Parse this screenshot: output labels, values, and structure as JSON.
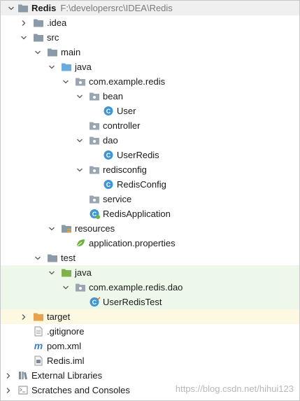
{
  "project": {
    "name": "Redis",
    "path": "F:\\developersrc\\IDEA\\Redis"
  },
  "nodes": {
    "idea": ".idea",
    "src": "src",
    "main": "main",
    "main_java": "java",
    "pkg": "com.example.redis",
    "bean": "bean",
    "user": "User",
    "controller": "controller",
    "dao": "dao",
    "user_redis": "UserRedis",
    "redisconfig": "redisconfig",
    "redis_config": "RedisConfig",
    "service": "service",
    "redis_application": "RedisApplication",
    "resources": "resources",
    "app_props": "application.properties",
    "test": "test",
    "test_java": "java",
    "test_pkg": "com.example.redis.dao",
    "user_redis_test": "UserRedisTest",
    "target": "target",
    "gitignore": ".gitignore",
    "pom": "pom.xml",
    "iml": "Redis.iml",
    "external_libraries": "External Libraries",
    "scratches": "Scratches and Consoles"
  },
  "watermark": "https://blog.csdn.net/hihui123",
  "colors": {
    "folder": "#8a9aa9",
    "source_folder": "#6aabde",
    "test_folder": "#7fb24d",
    "excluded_folder": "#e6a34b",
    "class_icon": "#3d95d1",
    "test_row_bg": "#eef8ea",
    "excluded_row_bg": "#fdf8e1"
  }
}
